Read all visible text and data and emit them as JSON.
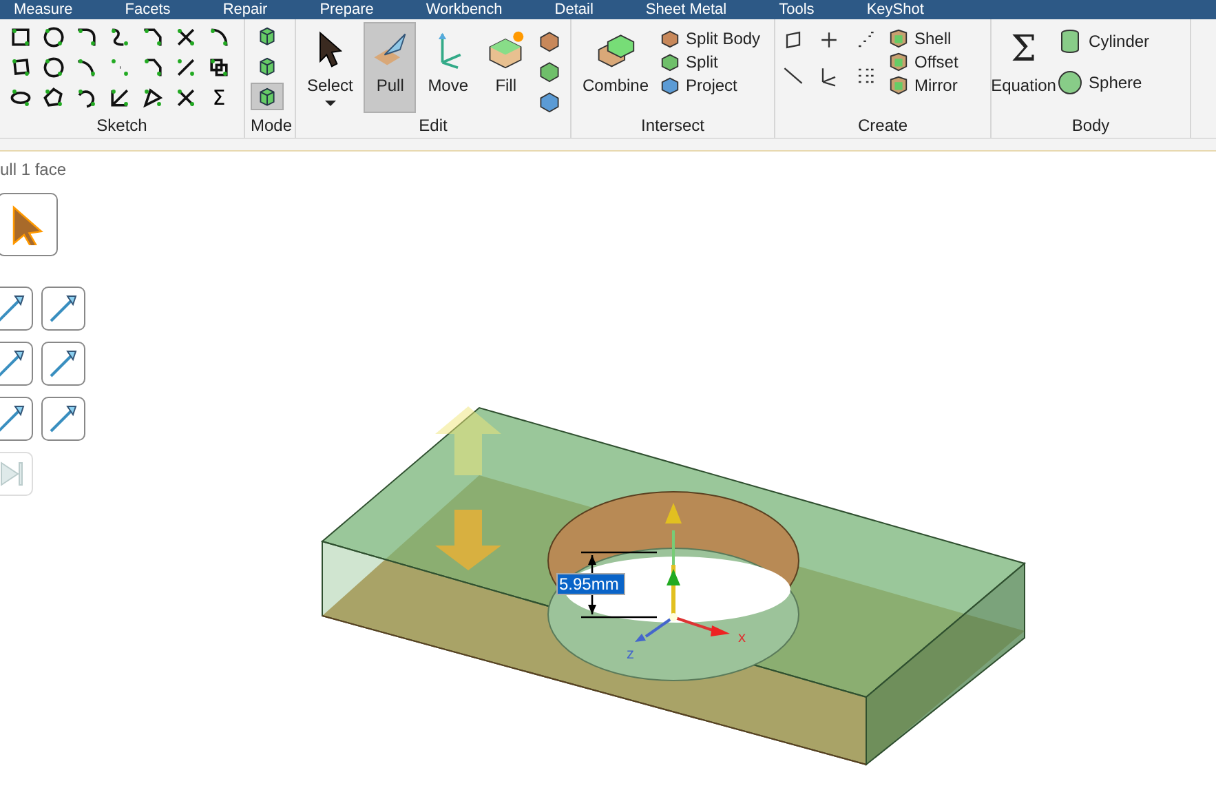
{
  "menu_tabs": [
    {
      "label": "Measure"
    },
    {
      "label": "Facets"
    },
    {
      "label": "Repair"
    },
    {
      "label": "Prepare"
    },
    {
      "label": "Workbench"
    },
    {
      "label": "Detail"
    },
    {
      "label": "Sheet Metal"
    },
    {
      "label": "Tools"
    },
    {
      "label": "KeyShot"
    }
  ],
  "ribbon_groups": [
    {
      "kind": "sketch",
      "label": "Sketch",
      "sum_glyph": "Σ"
    },
    {
      "kind": "mode",
      "label": "Mode",
      "modes": [
        {
          "selected": false
        },
        {
          "selected": false
        },
        {
          "selected": true
        }
      ]
    },
    {
      "kind": "edit",
      "label": "Edit",
      "tools": [
        {
          "label": "Select",
          "selected": false,
          "dropdown": true
        },
        {
          "label": "Pull",
          "selected": true,
          "dropdown": false
        },
        {
          "label": "Move",
          "selected": false,
          "dropdown": false
        },
        {
          "label": "Fill",
          "selected": false,
          "dropdown": false
        }
      ]
    },
    {
      "kind": "intersect",
      "label": "Intersect",
      "large": {
        "label": "Combine"
      },
      "small": [
        {
          "label": "Split Body"
        },
        {
          "label": "Split"
        },
        {
          "label": "Project"
        }
      ]
    },
    {
      "kind": "create",
      "label": "Create",
      "small": [
        {
          "label": "Shell"
        },
        {
          "label": "Offset"
        },
        {
          "label": "Mirror"
        }
      ]
    },
    {
      "kind": "body",
      "label": "Body",
      "large": {
        "label": "Equation",
        "glyph": "Σ"
      },
      "small": [
        {
          "label": "Cylinder"
        },
        {
          "label": "Sphere"
        }
      ]
    }
  ],
  "tool_panel": {
    "status_text": "ull 1 face",
    "palette": [
      {
        "disabled": false
      },
      {
        "disabled": false
      },
      {
        "disabled": false
      },
      {
        "disabled": false
      },
      {
        "disabled": false
      },
      {
        "disabled": false
      },
      {
        "disabled": false
      },
      {
        "disabled": true
      }
    ]
  },
  "viewport": {
    "dimension": {
      "value": "5.95mm",
      "selected": true
    },
    "triad": {
      "x_label": "x",
      "z_label": "z"
    }
  }
}
